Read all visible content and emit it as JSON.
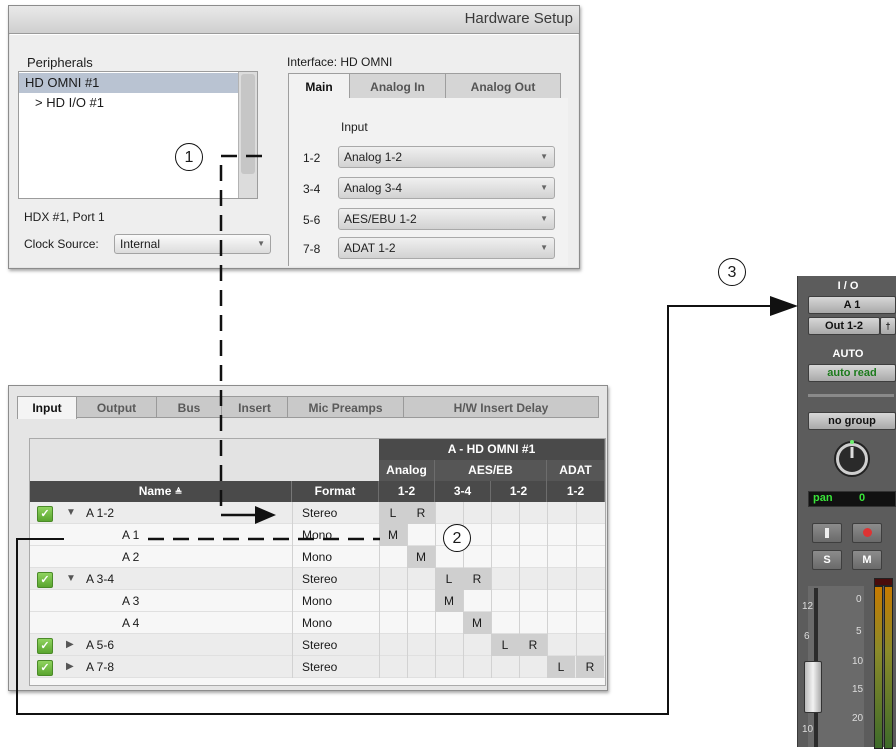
{
  "hardware_setup": {
    "title": "Hardware Setup",
    "peripherals_label": "Peripherals",
    "peripherals": [
      "HD OMNI #1",
      "> HD I/O #1"
    ],
    "port_label": "HDX #1, Port 1",
    "clock_source_label": "Clock Source:",
    "clock_source_value": "Internal",
    "interface_label": "Interface: HD OMNI",
    "tabs": [
      "Main",
      "Analog In",
      "Analog Out"
    ],
    "input_heading": "Input",
    "inputs": [
      {
        "channel": "1-2",
        "value": "Analog 1-2"
      },
      {
        "channel": "3-4",
        "value": "Analog 3-4"
      },
      {
        "channel": "5-6",
        "value": "AES/EBU 1-2"
      },
      {
        "channel": "7-8",
        "value": "ADAT 1-2"
      }
    ]
  },
  "io_setup": {
    "tabs": [
      "Input",
      "Output",
      "Bus",
      "Insert",
      "Mic Preamps",
      "H/W Insert Delay"
    ],
    "device_header": "A - HD OMNI #1",
    "group_headers": [
      "Analog",
      "AES/EB",
      "ADAT"
    ],
    "pair_headers": [
      "1-2",
      "3-4",
      "1-2",
      "1-2"
    ],
    "col_name": "Name",
    "col_format": "Format",
    "rows": [
      {
        "name": "A 1-2",
        "format": "Stereo"
      },
      {
        "name": "A 1",
        "format": "Mono"
      },
      {
        "name": "A 2",
        "format": "Mono"
      },
      {
        "name": "A 3-4",
        "format": "Stereo"
      },
      {
        "name": "A 3",
        "format": "Mono"
      },
      {
        "name": "A 4",
        "format": "Mono"
      },
      {
        "name": "A 5-6",
        "format": "Stereo"
      },
      {
        "name": "A 7-8",
        "format": "Stereo"
      }
    ],
    "matrix_letters": {
      "L": "L",
      "R": "R",
      "M": "M"
    }
  },
  "mixer_strip": {
    "io_label": "I / O",
    "input_value": "A 1",
    "output_value": "Out 1-2",
    "auto_label": "AUTO",
    "auto_value": "auto read",
    "group_value": "no group",
    "pan_label": "pan",
    "pan_value": "0",
    "solo": "S",
    "mute": "M",
    "scale": [
      "12",
      "6",
      "0",
      "5",
      "10",
      "0",
      "5",
      "10",
      "15",
      "20"
    ]
  },
  "callouts": [
    "1",
    "2",
    "3"
  ]
}
